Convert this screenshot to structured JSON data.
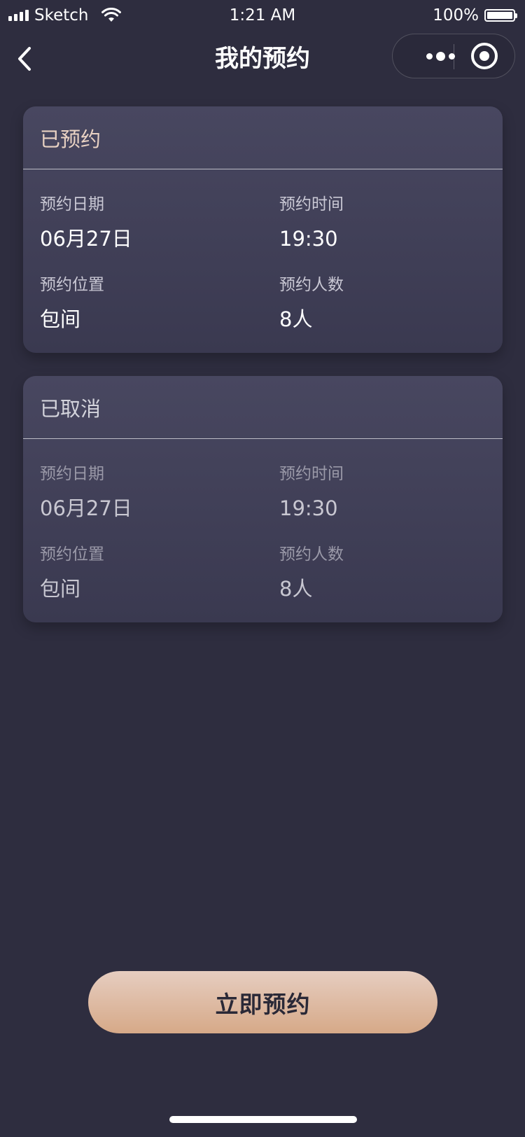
{
  "status_bar": {
    "carrier": "Sketch",
    "time": "1:21 AM",
    "battery_percent": "100%",
    "battery_level": 1.0,
    "icons": [
      "signal-icon",
      "wifi-icon",
      "battery-icon"
    ]
  },
  "nav": {
    "title": "我的预约",
    "back_icon": "chevron-left-icon",
    "more_icon": "more-dots-icon",
    "close_icon": "target-circle-icon"
  },
  "reservations": [
    {
      "status": "已预约",
      "date_label": "预约日期",
      "date": "06月27日",
      "time_label": "预约时间",
      "time": "19:30",
      "location_label": "预约位置",
      "location": "包间",
      "people_label": "预约人数",
      "people": "8人"
    },
    {
      "status": "已取消",
      "date_label": "预约日期",
      "date": "06月27日",
      "time_label": "预约时间",
      "time": "19:30",
      "location_label": "预约位置",
      "location": "包间",
      "people_label": "预约人数",
      "people": "8人"
    }
  ],
  "actions": {
    "book_label": "立即预约"
  },
  "colors": {
    "background": "#2e2d3f",
    "card": "#42415a",
    "accent_gradient_start": "#e6cdc0",
    "accent_gradient_end": "#d6a988",
    "active_status": "#e9d2c3"
  }
}
